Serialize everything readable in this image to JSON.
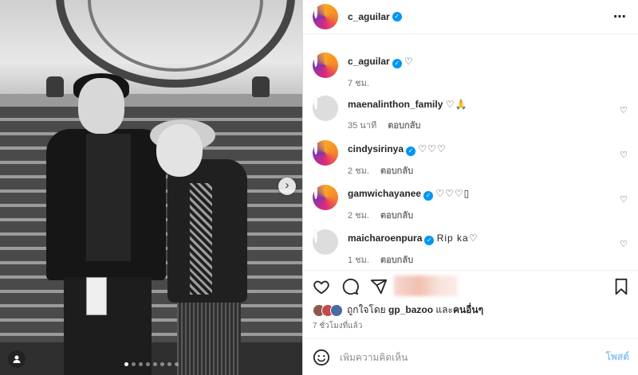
{
  "post": {
    "author": "c_aguilar",
    "more_icon": "⋯"
  },
  "caption": {
    "username": "c_aguilar",
    "text": "♡",
    "time": "7 ชม."
  },
  "comments": [
    {
      "username": "maenalinthon_family",
      "text": "♡🙏",
      "time": "35 นาที",
      "reply": "ตอบกลับ",
      "verified": false
    },
    {
      "username": "cindysirinya",
      "text": "♡♡♡",
      "time": "2 ชม.",
      "reply": "ตอบกลับ",
      "verified": true
    },
    {
      "username": "gamwichayanee",
      "text": "♡♡♡▯",
      "time": "2 ชม.",
      "reply": "ตอบกลับ",
      "verified": true
    },
    {
      "username": "maicharoenpura",
      "text": "Rip ka♡",
      "time": "1 ชม.",
      "reply": "ตอบกลับ",
      "verified": true
    }
  ],
  "likes": {
    "prefix": "ถูกใจโดย",
    "user": "gp_bazoo",
    "connector": "และ",
    "others": "คนอื่นๆ"
  },
  "posted_ago": "7 ชั่วโมงที่แล้ว",
  "composer": {
    "placeholder": "เพิ่มความคิดเห็น",
    "post_label": "โพสต์"
  },
  "carousel": {
    "next_icon": "›",
    "slide_count": 8,
    "active_index": 0
  },
  "colors": {
    "verified": "#0095f6",
    "post_button": "#8fc6f5",
    "meta_text": "#737373"
  }
}
